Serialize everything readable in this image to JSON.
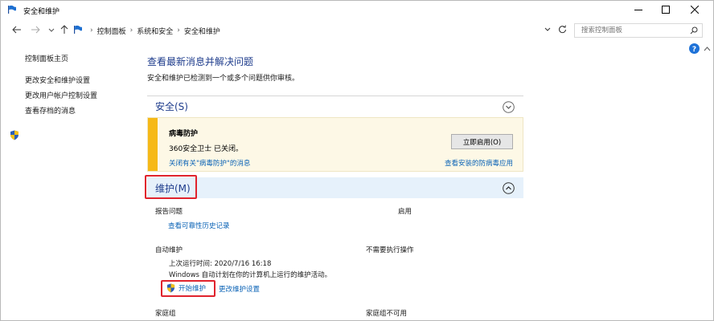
{
  "window": {
    "title": "安全和维护"
  },
  "address": {
    "breadcrumbs": [
      "控制面板",
      "系统和安全",
      "安全和维护"
    ],
    "search_placeholder": "搜索控制面板"
  },
  "sidebar": {
    "items": [
      {
        "label": "控制面板主页"
      },
      {
        "label": "更改安全和维护设置"
      },
      {
        "label": "更改用户帐户控制设置"
      },
      {
        "label": "查看存档的消息"
      }
    ]
  },
  "main": {
    "title": "查看最新消息并解决问题",
    "subtitle": "安全和维护已检测到一个或多个问题供你审核。",
    "security": {
      "heading": "安全(S)",
      "alert": {
        "title": "病毒防护",
        "description": "360安全卫士 已关闭。",
        "dismiss_link": "关闭有关\"病毒防护\"的消息",
        "button_label": "立即启用(O)",
        "view_link": "查看安装的防病毒应用"
      }
    },
    "maintenance": {
      "heading": "维护(M)",
      "report_label": "报告问题",
      "report_value": "启用",
      "reliability_link": "查看可靠性历史记录",
      "auto_label": "自动维护",
      "auto_value": "不需要执行操作",
      "last_run": "上次运行时间: 2020/7/16 16:18",
      "schedule_text": "Windows 自动计划在你的计算机上运行的维护活动。",
      "start_button": "开始维护",
      "change_link": "更改维护设置",
      "homegroup_label": "家庭组",
      "homegroup_value": "家庭组不可用"
    }
  },
  "colors": {
    "heading_blue": "#1e3c8c",
    "link_blue": "#0b63b6",
    "warning_yellow": "#f6b918",
    "highlight_red": "#e0232d",
    "section_bg": "#e6f1fb"
  }
}
